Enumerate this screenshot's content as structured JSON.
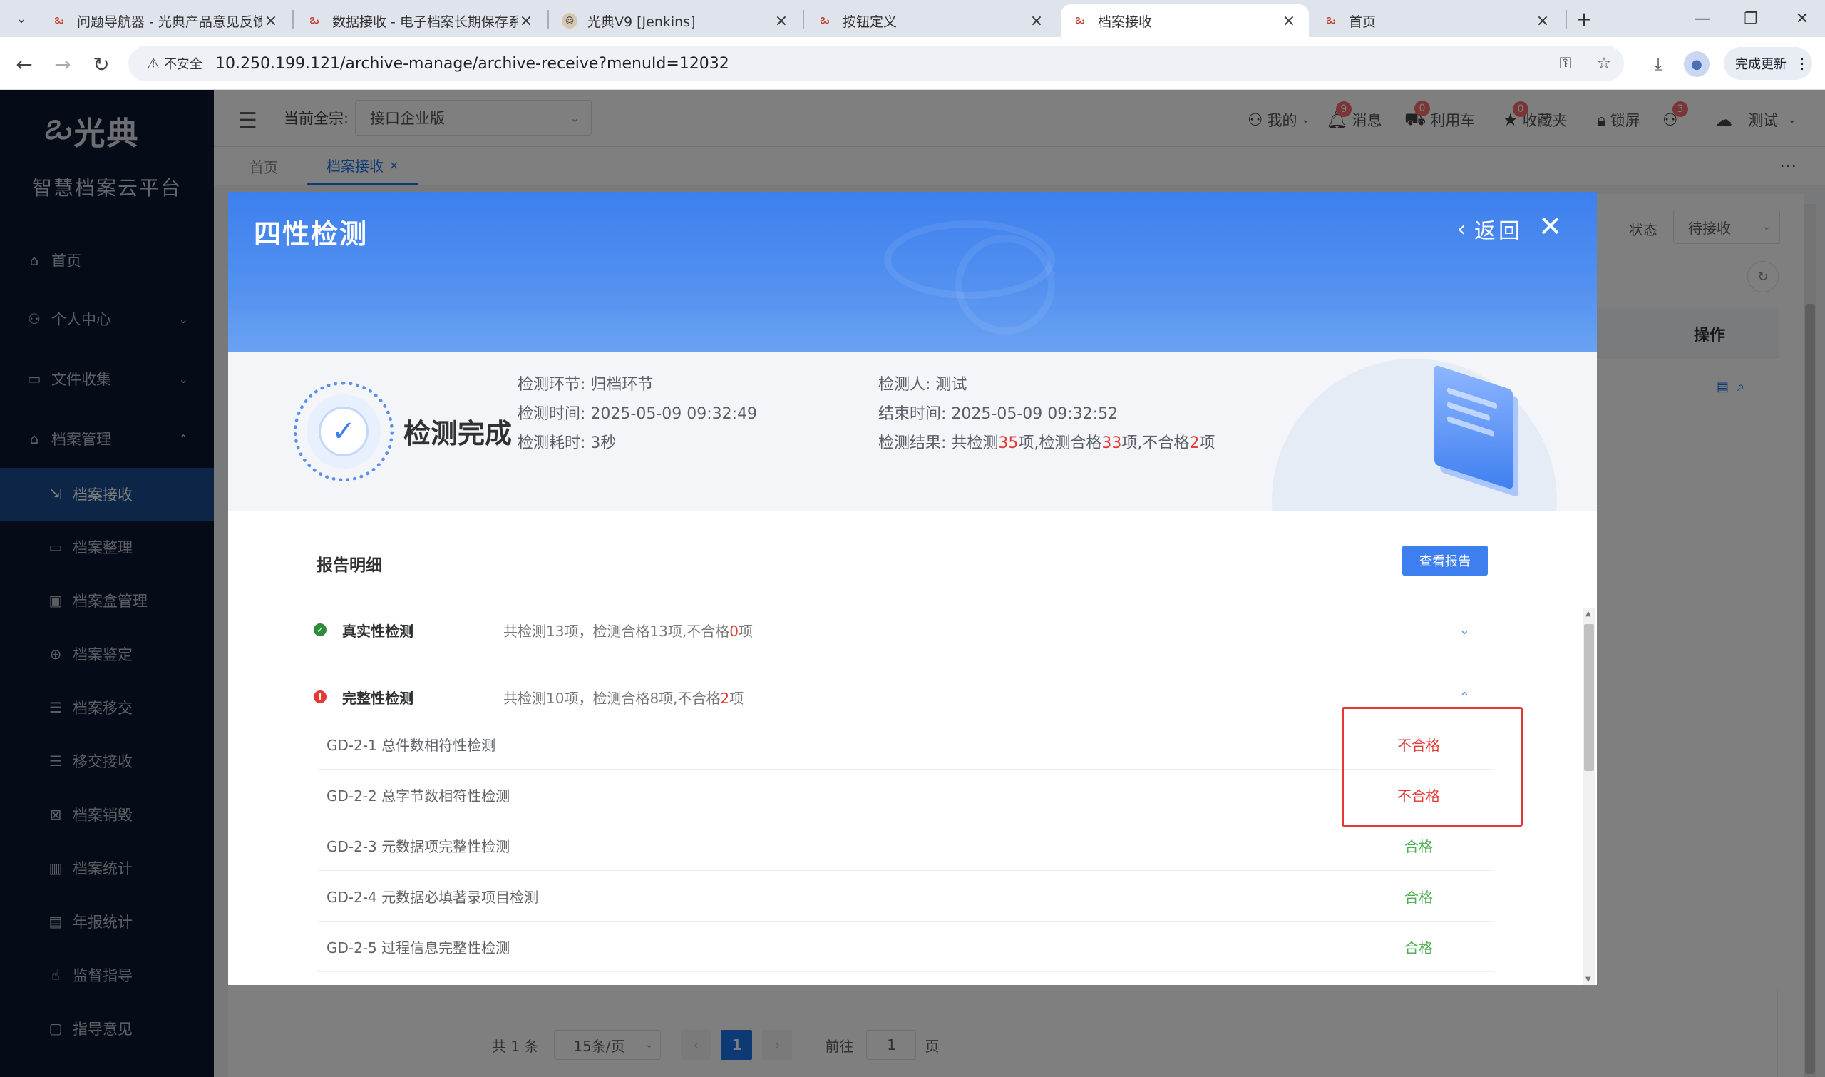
{
  "browser": {
    "tabs": [
      {
        "title": "问题导航器 - 光典产品意见反馈"
      },
      {
        "title": "数据接收 - 电子档案长期保存系"
      },
      {
        "title": "光典V9 [Jenkins]"
      },
      {
        "title": "按钮定义"
      },
      {
        "title": "档案接收"
      },
      {
        "title": "首页"
      }
    ],
    "not_secure": "不安全",
    "url": "10.250.199.121/archive-manage/archive-receive?menuId=12032",
    "update_label": "完成更新"
  },
  "sidebar": {
    "logo_text": "光典",
    "platform_name": "智慧档案云平台",
    "items": [
      {
        "label": "首页",
        "icon": "home-icon"
      },
      {
        "label": "个人中心",
        "icon": "user-icon"
      },
      {
        "label": "文件收集",
        "icon": "briefcase-icon"
      },
      {
        "label": "档案管理",
        "icon": "bank-icon"
      },
      {
        "label": "档案接收",
        "icon": "receive-icon"
      },
      {
        "label": "档案整理",
        "icon": "folder-icon"
      },
      {
        "label": "档案盒管理",
        "icon": "box-icon"
      },
      {
        "label": "档案鉴定",
        "icon": "appraise-icon"
      },
      {
        "label": "档案移交",
        "icon": "list-icon"
      },
      {
        "label": "移交接收",
        "icon": "list-icon"
      },
      {
        "label": "档案销毁",
        "icon": "destroy-icon"
      },
      {
        "label": "档案统计",
        "icon": "bar-chart-icon"
      },
      {
        "label": "年报统计",
        "icon": "report-icon"
      },
      {
        "label": "监督指导",
        "icon": "hand-icon"
      },
      {
        "label": "指导意见",
        "icon": "comment-icon"
      }
    ]
  },
  "topbar": {
    "qz_label": "当前全宗:",
    "qz_value": "接口企业版",
    "mine": "我的",
    "messages": "消息",
    "messages_count": "9",
    "cart": "利用车",
    "cart_count": "0",
    "favorites": "收藏夹",
    "favorites_count": "0",
    "lock": "锁屏",
    "user_count": "3",
    "user": "测试"
  },
  "tags": {
    "home": "首页",
    "current": "档案接收"
  },
  "page": {
    "status_label": "状态",
    "status_value": "待接收",
    "op_header": "操作",
    "pagination": {
      "total": "共 1 条",
      "page_size": "15条/页",
      "current": "1",
      "goto": "前往",
      "goto_value": "1",
      "page_unit": "页"
    }
  },
  "modal": {
    "title": "四性检测",
    "back": "返回",
    "done": "检测完成",
    "info": {
      "stage": "检测环节: 归档环节",
      "time": "检测时间:  2025-05-09 09:32:49",
      "duration": "检测耗时:  3秒",
      "inspector": "检测人: 测试",
      "end": "结束时间:  2025-05-09 09:32:52",
      "result_prefix": "检测结果:  共检测",
      "result_total": "35",
      "result_mid": "项,检测合格",
      "result_pass": "33",
      "result_mid2": "项,不合格",
      "result_fail": "2",
      "result_suffix": "项"
    },
    "report_title": "报告明细",
    "report_btn": "查看报告",
    "groups": [
      {
        "name": "真实性检测",
        "summary": "共检测13项，检测合格13项,不合格",
        "fail": "0",
        "unit": "项"
      },
      {
        "name": "完整性检测",
        "summary": "共检测10项，检测合格8项,不合格",
        "fail": "2",
        "unit": "项"
      }
    ],
    "details": [
      {
        "name": "GD-2-1 总件数相符性检测",
        "result": "不合格"
      },
      {
        "name": "GD-2-2 总字节数相符性检测",
        "result": "不合格"
      },
      {
        "name": "GD-2-3 元数据项完整性检测",
        "result": "合格"
      },
      {
        "name": "GD-2-4 元数据必填著录项目检测",
        "result": "合格"
      },
      {
        "name": "GD-2-5 过程信息完整性检测",
        "result": "合格"
      }
    ]
  }
}
